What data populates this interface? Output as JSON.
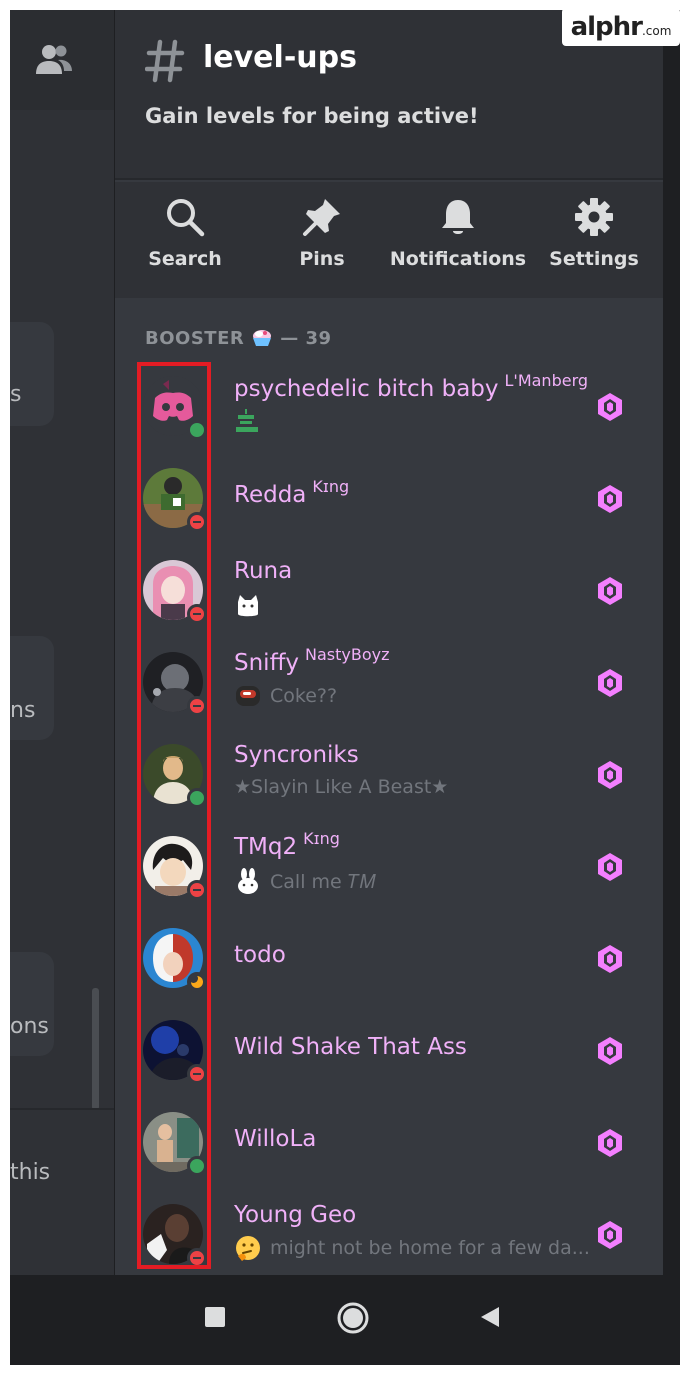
{
  "watermark": {
    "brand": "alphr",
    "tld": ".com"
  },
  "left_panel": {
    "fragments": [
      "s",
      "ns",
      "ons",
      "this"
    ]
  },
  "header": {
    "channel_name": "level-ups",
    "channel_topic": "Gain levels for being active!"
  },
  "actions": [
    {
      "label": "Search",
      "icon": "search-icon"
    },
    {
      "label": "Pins",
      "icon": "pin-icon"
    },
    {
      "label": "Notifications",
      "icon": "bell-icon"
    },
    {
      "label": "Settings",
      "icon": "gear-icon"
    }
  ],
  "section": {
    "label": "BOOSTER",
    "emoji": "shaved-ice-emoji",
    "count": "— 39"
  },
  "members": [
    {
      "name": "psychedelic bitch baby",
      "tag": "L'Manberg",
      "status_text": "",
      "status_emoji": "simp-for-shane-sticker",
      "presence": "online"
    },
    {
      "name": "Redda",
      "tag": "Kɪng",
      "status_text": "",
      "status_emoji": "",
      "presence": "dnd"
    },
    {
      "name": "Runa",
      "tag": "",
      "status_text": "",
      "status_emoji": "white-cat-sticker",
      "presence": "dnd"
    },
    {
      "name": "Sniffy",
      "tag": "NastyBoyz",
      "status_text": "Coke??",
      "status_emoji": "among-us-visor-emoji",
      "presence": "dnd"
    },
    {
      "name": "Syncroniks",
      "tag": "",
      "status_text": "★Slayin Like A Beast★",
      "status_emoji": "",
      "presence": "online"
    },
    {
      "name": "TMq2",
      "tag": "Kɪng",
      "status_text": "Call me 𝑇𝑀",
      "status_emoji": "bunny-sticker",
      "presence": "dnd"
    },
    {
      "name": "todo",
      "tag": "",
      "status_text": "",
      "status_emoji": "",
      "presence": "idle"
    },
    {
      "name": "Wild Shake That Ass",
      "tag": "",
      "status_text": "",
      "status_emoji": "",
      "presence": "dnd"
    },
    {
      "name": "WilloLa",
      "tag": "",
      "status_text": "",
      "status_emoji": "",
      "presence": "online"
    },
    {
      "name": "Young Geo",
      "tag": "",
      "status_text": "might not be home for a few da...",
      "status_emoji": "thinking-face-emoji",
      "presence": "dnd"
    }
  ],
  "colors": {
    "booster_name": "#f0b1f8",
    "boost_icon": "#f47fff",
    "highlight_box": "#e41c24",
    "online": "#3ba55d",
    "dnd": "#ed4245",
    "idle": "#faa81a"
  },
  "navbar": {
    "buttons": [
      "recents-square-icon",
      "home-circle-icon",
      "back-triangle-icon"
    ]
  }
}
